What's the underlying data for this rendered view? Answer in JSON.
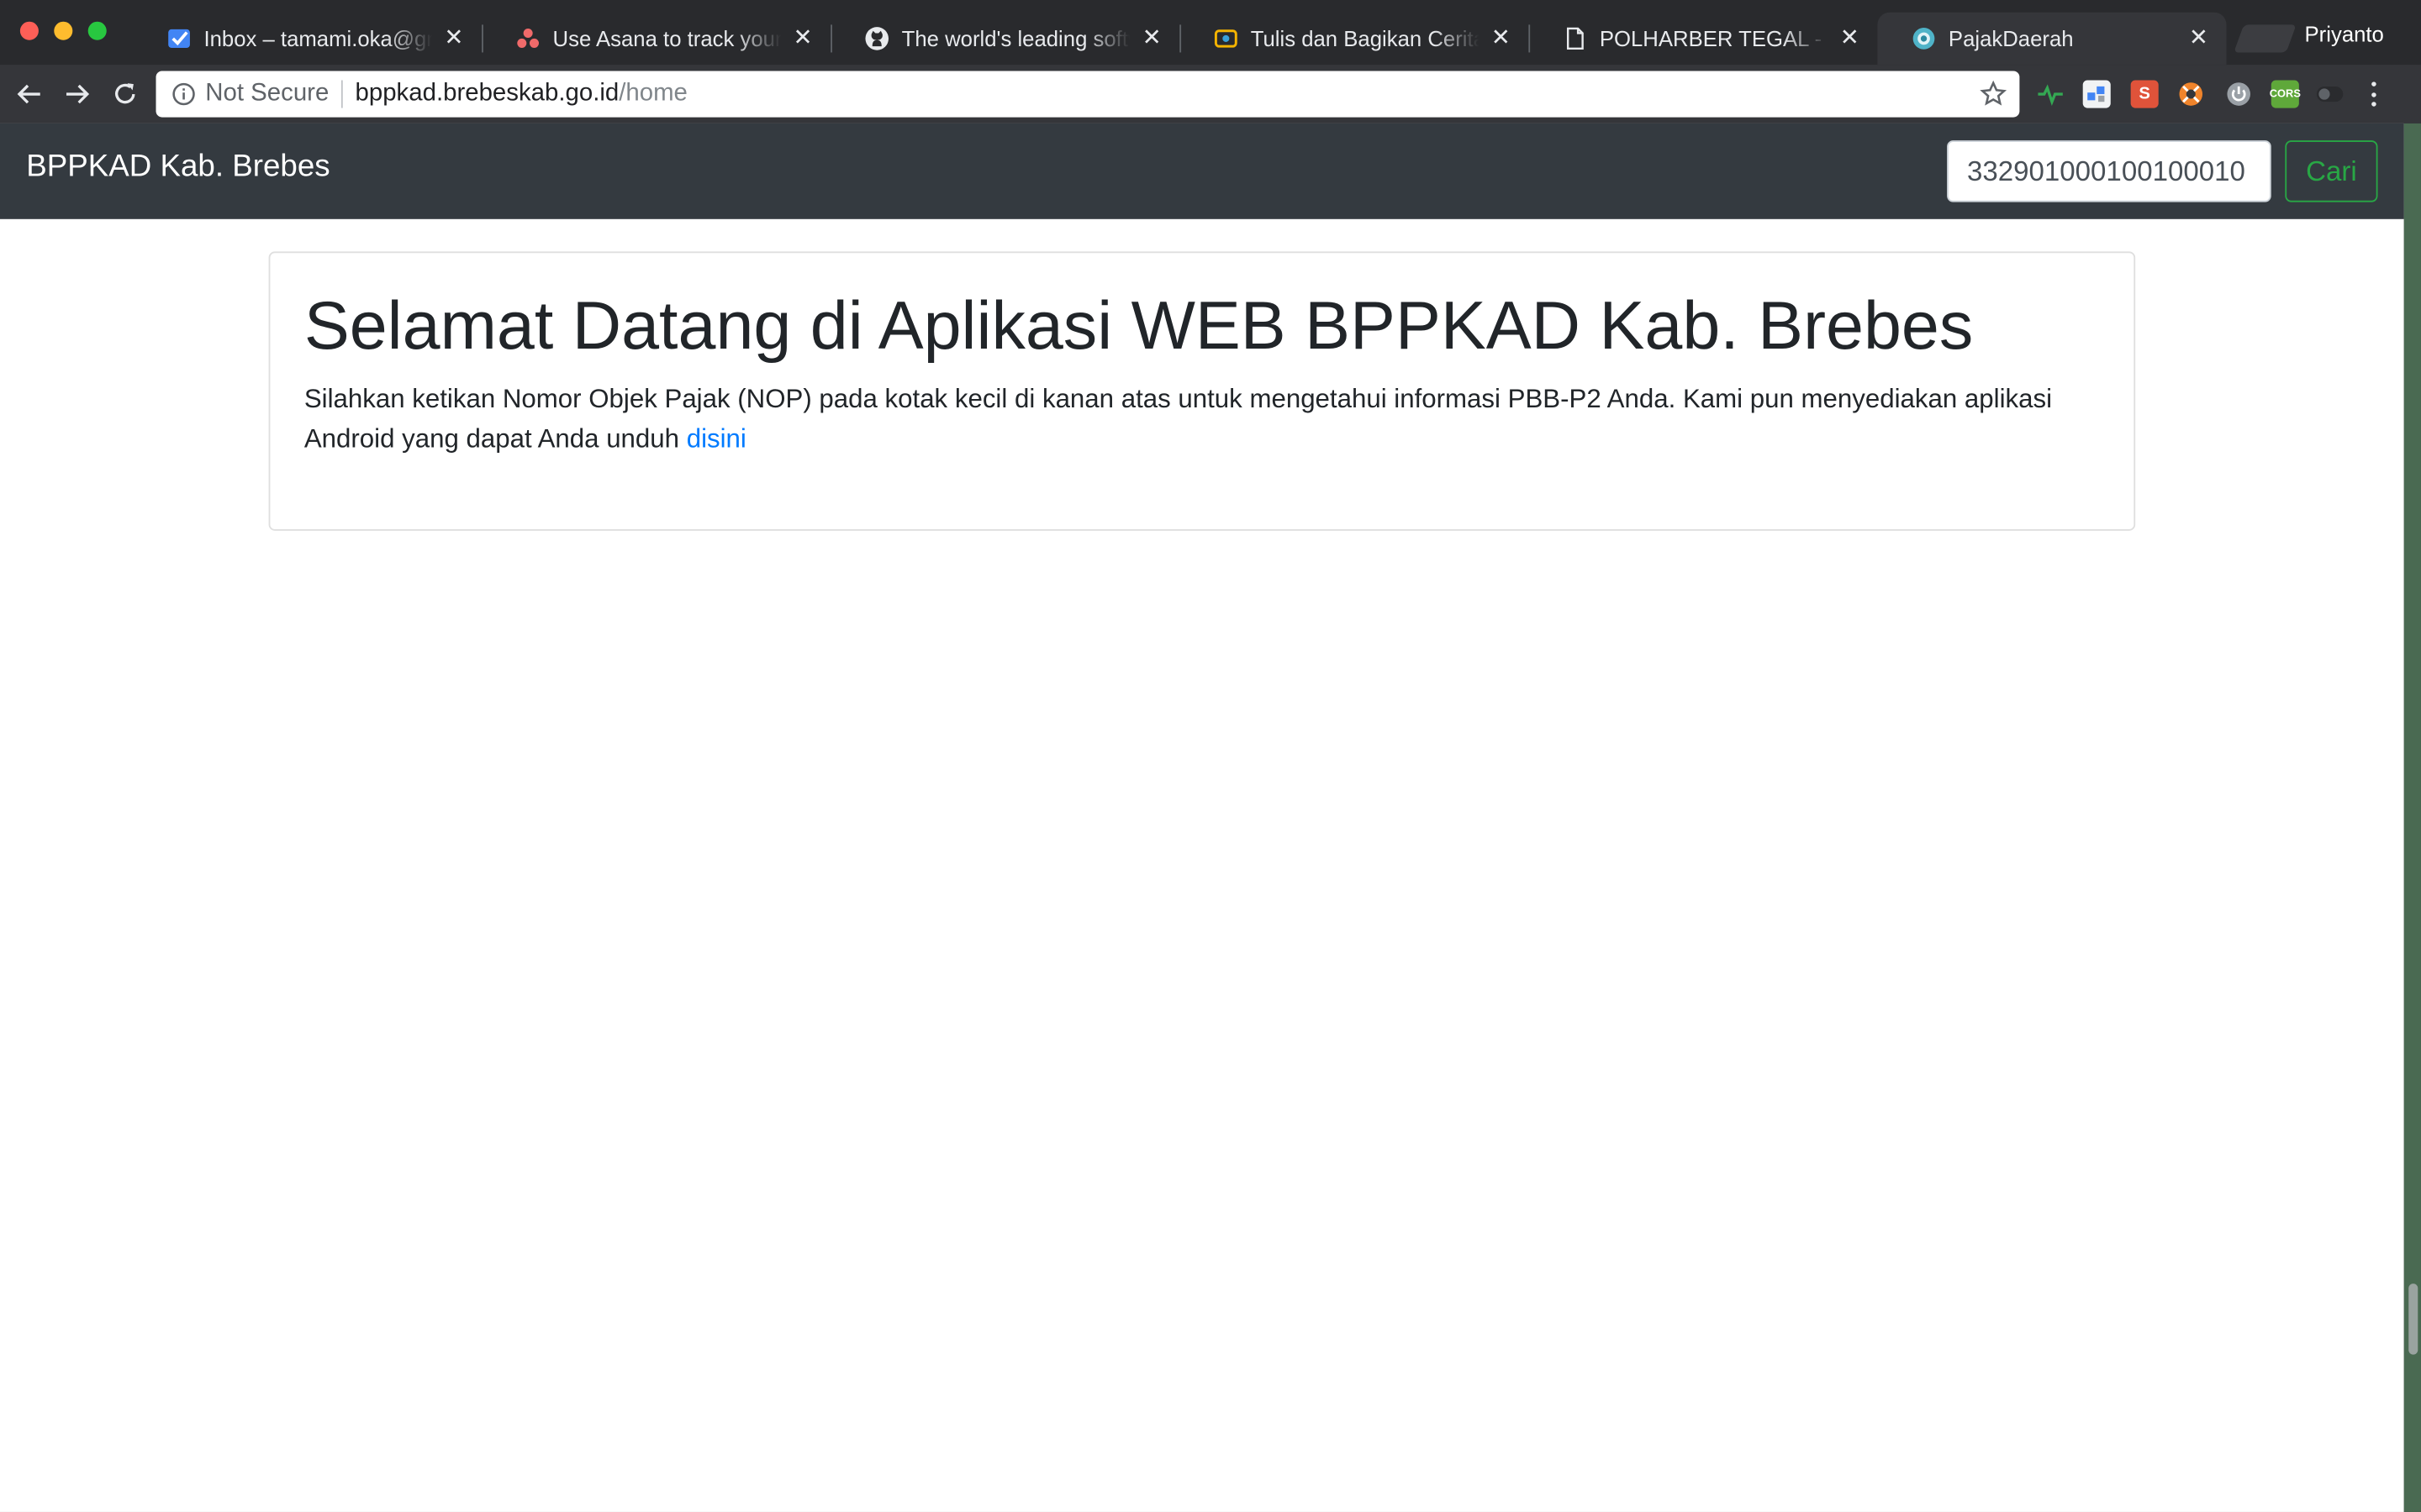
{
  "browser": {
    "profile_name": "Priyanto",
    "tabs": [
      {
        "title": "Inbox – tamami.oka@gmail.com",
        "icon": "inbox-check-icon",
        "active": false
      },
      {
        "title": "Use Asana to track your team",
        "icon": "asana-icon",
        "active": false
      },
      {
        "title": "The world's leading software",
        "icon": "github-icon",
        "active": false
      },
      {
        "title": "Tulis dan Bagikan Ceritamu",
        "icon": "wattpad-icon",
        "active": false
      },
      {
        "title": "POLHARBER TEGAL - Sistem",
        "icon": "document-icon",
        "active": false
      },
      {
        "title": "PajakDaerah",
        "icon": "globe-icon",
        "active": true
      }
    ],
    "address_bar": {
      "security_label": "Not Secure",
      "host": "bppkad.brebeskab.go.id",
      "path": "/home"
    },
    "extensions": [
      {
        "name": "pulse-extension-icon",
        "color": "#34a853",
        "glyph": ""
      },
      {
        "name": "puzzle-extension-icon",
        "color": "#4285f4",
        "glyph": ""
      },
      {
        "name": "s-extension-icon",
        "color": "#e0533a",
        "glyph": "S"
      },
      {
        "name": "lifebuoy-extension-icon",
        "color": "#f0842b",
        "glyph": ""
      },
      {
        "name": "power-extension-icon",
        "color": "#9aa0a6",
        "glyph": ""
      },
      {
        "name": "cors-extension-icon",
        "color": "#5fa83a",
        "glyph": "CORS"
      },
      {
        "name": "toggle-extension-icon",
        "color": "#3c4043",
        "glyph": ""
      }
    ]
  },
  "page": {
    "navbar": {
      "brand": "BPPKAD Kab. Brebes",
      "search_value": "332901000100100010",
      "search_button": "Cari"
    },
    "jumbotron": {
      "heading": "Selamat Datang di Aplikasi WEB BPPKAD Kab. Brebes",
      "text_before_link": "Silahkan ketikan Nomor Objek Pajak (NOP) pada kotak kecil di kanan atas untuk mengetahui informasi PBB-P2 Anda. Kami pun menyediakan aplikasi Android yang dapat Anda unduh ",
      "link_text": "disini"
    }
  }
}
